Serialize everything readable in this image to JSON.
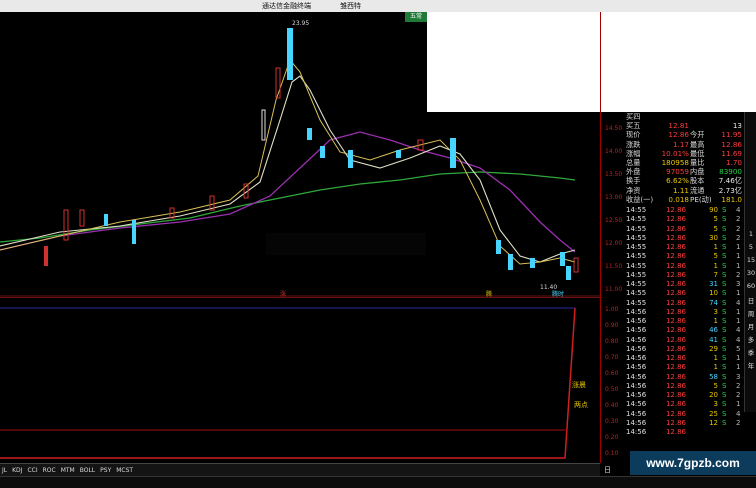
{
  "window": {
    "title": "通达信金融终端",
    "subtitle": "雏西特"
  },
  "top_badge": "五常",
  "chart": {
    "high_label": "23.95",
    "low_label": "11.40",
    "price_axis": [
      "14.50",
      "14.00",
      "13.50",
      "13.00",
      "12.50",
      "12.00",
      "11.50",
      "11.00",
      "10.50"
    ],
    "indicator_axis": [
      "1.00",
      "0.90",
      "0.80",
      "0.70",
      "0.60",
      "0.50",
      "0.40",
      "0.30",
      "0.20",
      "0.10"
    ],
    "marker_up": "涨",
    "marker_mid": "腾",
    "marker_low": "腾时",
    "indicator_label_1": "涨晨",
    "indicator_label_2": "两点",
    "bottom_tabs": [
      "JL",
      "KDJ",
      "CCI",
      "ROC",
      "MTM",
      "BOLL",
      "PSY",
      "MCST"
    ],
    "bottom_axis_end": "日"
  },
  "quote": {
    "rows": [
      {
        "l1": "买四",
        "v1": "",
        "v1c": "red",
        "l2": "",
        "v2": ""
      },
      {
        "l1": "买五",
        "v1": "12.81",
        "v1c": "red",
        "l2": "",
        "v2": "13",
        "v2c": "white"
      },
      {
        "l1": "现价",
        "v1": "12.86",
        "v1c": "red",
        "l2": "今开",
        "v2": "11.95",
        "v2c": "red"
      },
      {
        "l1": "涨跌",
        "v1": "1.17",
        "v1c": "red",
        "l2": "最高",
        "v2": "12.86",
        "v2c": "red"
      },
      {
        "l1": "涨幅",
        "v1": "10.01%",
        "v1c": "red",
        "l2": "最低",
        "v2": "11.69",
        "v2c": "red"
      },
      {
        "l1": "总量",
        "v1": "180958",
        "v1c": "yellow",
        "l2": "量比",
        "v2": "1.70",
        "v2c": "red"
      },
      {
        "l1": "外盘",
        "v1": "97059",
        "v1c": "red",
        "l2": "内盘",
        "v2": "83900",
        "v2c": "green"
      },
      {
        "l1": "换手",
        "v1": "6.62%",
        "v1c": "yellow",
        "l2": "股本",
        "v2": "7.46亿",
        "v2c": "white"
      },
      {
        "l1": "净资",
        "v1": "1.11",
        "v1c": "yellow",
        "l2": "流通",
        "v2": "2.73亿",
        "v2c": "white"
      },
      {
        "l1": "收益(一)",
        "v1": "0.018",
        "v1c": "yellow",
        "l2": "PE(动)",
        "v2": "181.0",
        "v2c": "yellow"
      }
    ],
    "ticks": [
      {
        "t": "14:55",
        "p": "12.86",
        "v": "90",
        "vc": "yellow",
        "f": "S",
        "n": "4"
      },
      {
        "t": "14:55",
        "p": "12.86",
        "v": "5",
        "vc": "yellow",
        "f": "S",
        "n": "2"
      },
      {
        "t": "14:55",
        "p": "12.86",
        "v": "5",
        "vc": "yellow",
        "f": "S",
        "n": "2"
      },
      {
        "t": "14:55",
        "p": "12.86",
        "v": "30",
        "vc": "yellow",
        "f": "S",
        "n": "2"
      },
      {
        "t": "14:55",
        "p": "12.86",
        "v": "1",
        "vc": "yellow",
        "f": "S",
        "n": "1"
      },
      {
        "t": "14:55",
        "p": "12.86",
        "v": "5",
        "vc": "yellow",
        "f": "S",
        "n": "1"
      },
      {
        "t": "14:55",
        "p": "12.86",
        "v": "1",
        "vc": "yellow",
        "f": "S",
        "n": "1"
      },
      {
        "t": "14:55",
        "p": "12.86",
        "v": "7",
        "vc": "yellow",
        "f": "S",
        "n": "2"
      },
      {
        "t": "14:55",
        "p": "12.86",
        "v": "31",
        "vc": "cyan",
        "f": "S",
        "n": "3"
      },
      {
        "t": "14:55",
        "p": "12.86",
        "v": "10",
        "vc": "yellow",
        "f": "S",
        "n": "1"
      },
      {
        "t": "14:55",
        "p": "12.86",
        "v": "74",
        "vc": "cyan",
        "f": "S",
        "n": "4"
      },
      {
        "t": "14:56",
        "p": "12.86",
        "v": "3",
        "vc": "yellow",
        "f": "S",
        "n": "1"
      },
      {
        "t": "14:56",
        "p": "12.86",
        "v": "1",
        "vc": "yellow",
        "f": "S",
        "n": "1"
      },
      {
        "t": "14:56",
        "p": "12.86",
        "v": "46",
        "vc": "cyan",
        "f": "S",
        "n": "4"
      },
      {
        "t": "14:56",
        "p": "12.86",
        "v": "41",
        "vc": "cyan",
        "f": "S",
        "n": "4"
      },
      {
        "t": "14:56",
        "p": "12.86",
        "v": "29",
        "vc": "yellow",
        "f": "S",
        "n": "5"
      },
      {
        "t": "14:56",
        "p": "12.86",
        "v": "1",
        "vc": "yellow",
        "f": "S",
        "n": "1"
      },
      {
        "t": "14:56",
        "p": "12.86",
        "v": "1",
        "vc": "yellow",
        "f": "S",
        "n": "1"
      },
      {
        "t": "14:56",
        "p": "12.86",
        "v": "58",
        "vc": "cyan",
        "f": "S",
        "n": "3"
      },
      {
        "t": "14:56",
        "p": "12.86",
        "v": "5",
        "vc": "yellow",
        "f": "S",
        "n": "2"
      },
      {
        "t": "14:56",
        "p": "12.86",
        "v": "20",
        "vc": "yellow",
        "f": "S",
        "n": "2"
      },
      {
        "t": "14:56",
        "p": "12.86",
        "v": "3",
        "vc": "yellow",
        "f": "S",
        "n": "1"
      },
      {
        "t": "14:56",
        "p": "12.86",
        "v": "25",
        "vc": "yellow",
        "f": "S",
        "n": "4"
      },
      {
        "t": "14:56",
        "p": "12.86",
        "v": "12",
        "vc": "yellow",
        "f": "S",
        "n": "2"
      },
      {
        "t": "14:56",
        "p": "12.86",
        "v": "",
        "vc": "yellow",
        "f": "",
        "n": ""
      }
    ]
  },
  "sidebar": [
    "1",
    "5",
    "15",
    "30",
    "60",
    "日",
    "周",
    "月",
    "多",
    "季",
    "年"
  ],
  "watermark": "www.7gpzb.com"
}
